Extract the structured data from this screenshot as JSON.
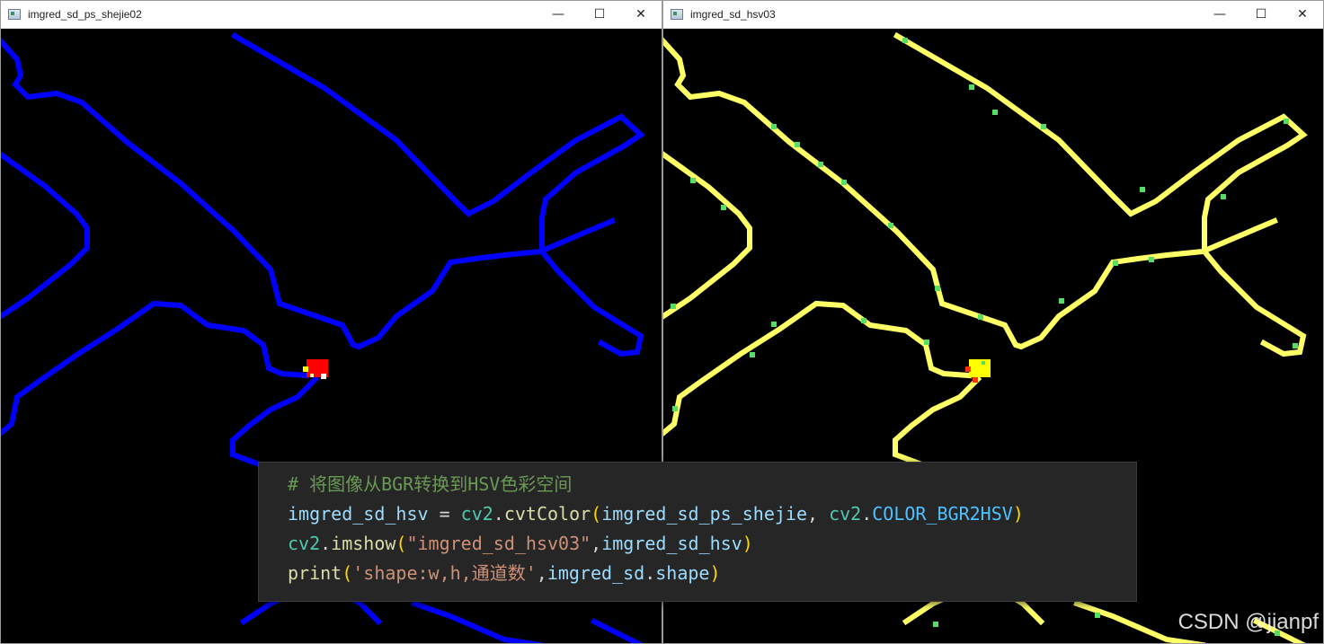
{
  "windows": {
    "left": {
      "title": "imgred_sd_ps_shejie02",
      "line_color": "#0000ff",
      "marker_color": "#ff0000",
      "marker_accent": "#ffff00"
    },
    "right": {
      "title": "imgred_sd_hsv03",
      "line_color": "#ffff66",
      "accent_color": "#66ff66",
      "marker_color": "#ffff00"
    },
    "controls": {
      "minimize": "—",
      "maximize": "☐",
      "close": "✕"
    }
  },
  "code": {
    "comment": "# 将图像从BGR转换到HSV色彩空间",
    "line2": {
      "var": "imgred_sd_hsv",
      "op": " = ",
      "mod": "cv2",
      "dot": ".",
      "fn": "cvtColor",
      "open": "(",
      "arg1": "imgred_sd_ps_shejie",
      "sep": ", ",
      "mod2": "cv2",
      "dot2": ".",
      "const": "COLOR_BGR2HSV",
      "close": ")"
    },
    "line3": {
      "mod": "cv2",
      "dot": ".",
      "fn": "imshow",
      "open": "(",
      "str": "\"imgred_sd_hsv03\"",
      "sep": ",",
      "arg": "imgred_sd_hsv",
      "close": ")"
    },
    "line4": {
      "fn": "print",
      "open": "(",
      "str": "'shape:w,h,通道数'",
      "sep": ",",
      "arg": "imgred_sd",
      "dot": ".",
      "attr": "shape",
      "close": ")"
    }
  },
  "watermark": "CSDN @jianpf"
}
